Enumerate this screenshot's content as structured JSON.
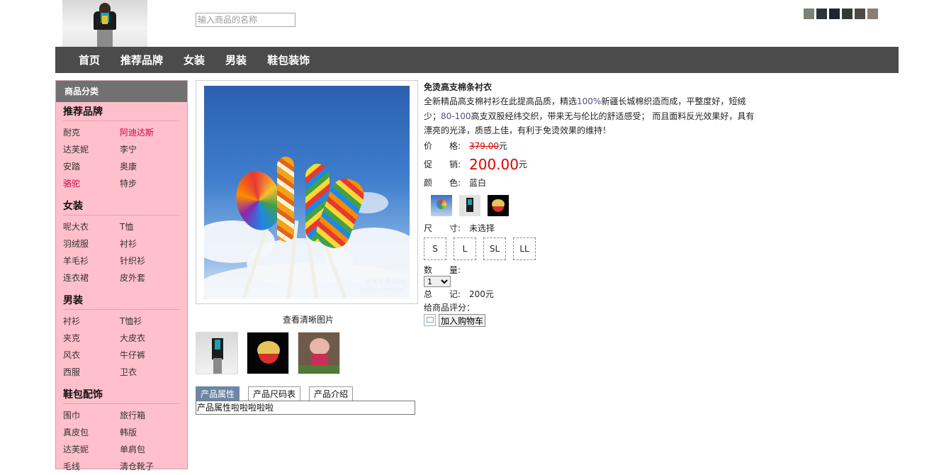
{
  "header": {
    "search_placeholder": "输入商品的名称",
    "top_thumbs": [
      "#7c8175",
      "#2e343d",
      "#1f2430",
      "#333a36",
      "#4d4a48",
      "#8a7e76"
    ]
  },
  "nav": [
    "首页",
    "推荐品牌",
    "女装",
    "男装",
    "鞋包装饰"
  ],
  "sidebar": {
    "title": "商品分类",
    "categories": [
      {
        "title": "推荐品牌",
        "items": [
          "耐克",
          "阿迪达斯",
          "达芙妮",
          "李宁",
          "安踏",
          "奥康",
          "骆驼",
          "特步"
        ],
        "highlight": [
          1,
          6
        ]
      },
      {
        "title": "女装",
        "items": [
          "呢大衣",
          "T恤",
          "羽绒服",
          "衬衫",
          "羊毛衫",
          "针织衫",
          "连衣裙",
          "皮外套"
        ],
        "highlight": []
      },
      {
        "title": "男装",
        "items": [
          "衬衫",
          "T恤衫",
          "夹克",
          "大皮衣",
          "风衣",
          "牛仔裤",
          "西服",
          "卫衣"
        ],
        "highlight": []
      },
      {
        "title": "鞋包配饰",
        "items": [
          "围巾",
          "旅行箱",
          "真皮包",
          "韩版",
          "达芙妮",
          "单肩包",
          "毛线",
          "清仓靴子"
        ],
        "highlight": []
      }
    ]
  },
  "product": {
    "image_watermark_1": "@星星爱初01",
    "image_watermark_2": "weibo.com/dyl",
    "view_clear": "查看清晰图片",
    "title": "免烫高支棉条衬衣",
    "desc_parts": [
      "全新精品高支棉衬衫在此提高品质，精选",
      "100%",
      "新疆长城棉织造而成，平整度好，短绒少；",
      "80-100",
      "高支双股经纬交织，带来无与伦比的舒适感受； 而且面料反光效果好，具有漂亮的光泽，质感上佳，有利于免烫效果的维持！"
    ],
    "price_label": "价　　格:",
    "price_old": "379.00",
    "price_unit": "元",
    "promo_label": "促　　销:",
    "price_new": "200.00",
    "color_label": "颜　　色:",
    "color_value": "蓝白",
    "size_label": "尺　　寸:",
    "size_value": "未选择",
    "sizes": [
      "S",
      "L",
      "SL",
      "LL"
    ],
    "qty_label": "数　　量:",
    "qty_value": "1",
    "total_label": "总　　记:",
    "total_value": "200元",
    "rating_label": "给商品评分：",
    "cart_button": "加入购物车"
  },
  "tabs": {
    "items": [
      "产品属性",
      "产品尺码表",
      "产品介绍"
    ],
    "active": 0,
    "content": "产品属性啦啦啦啦啦"
  }
}
